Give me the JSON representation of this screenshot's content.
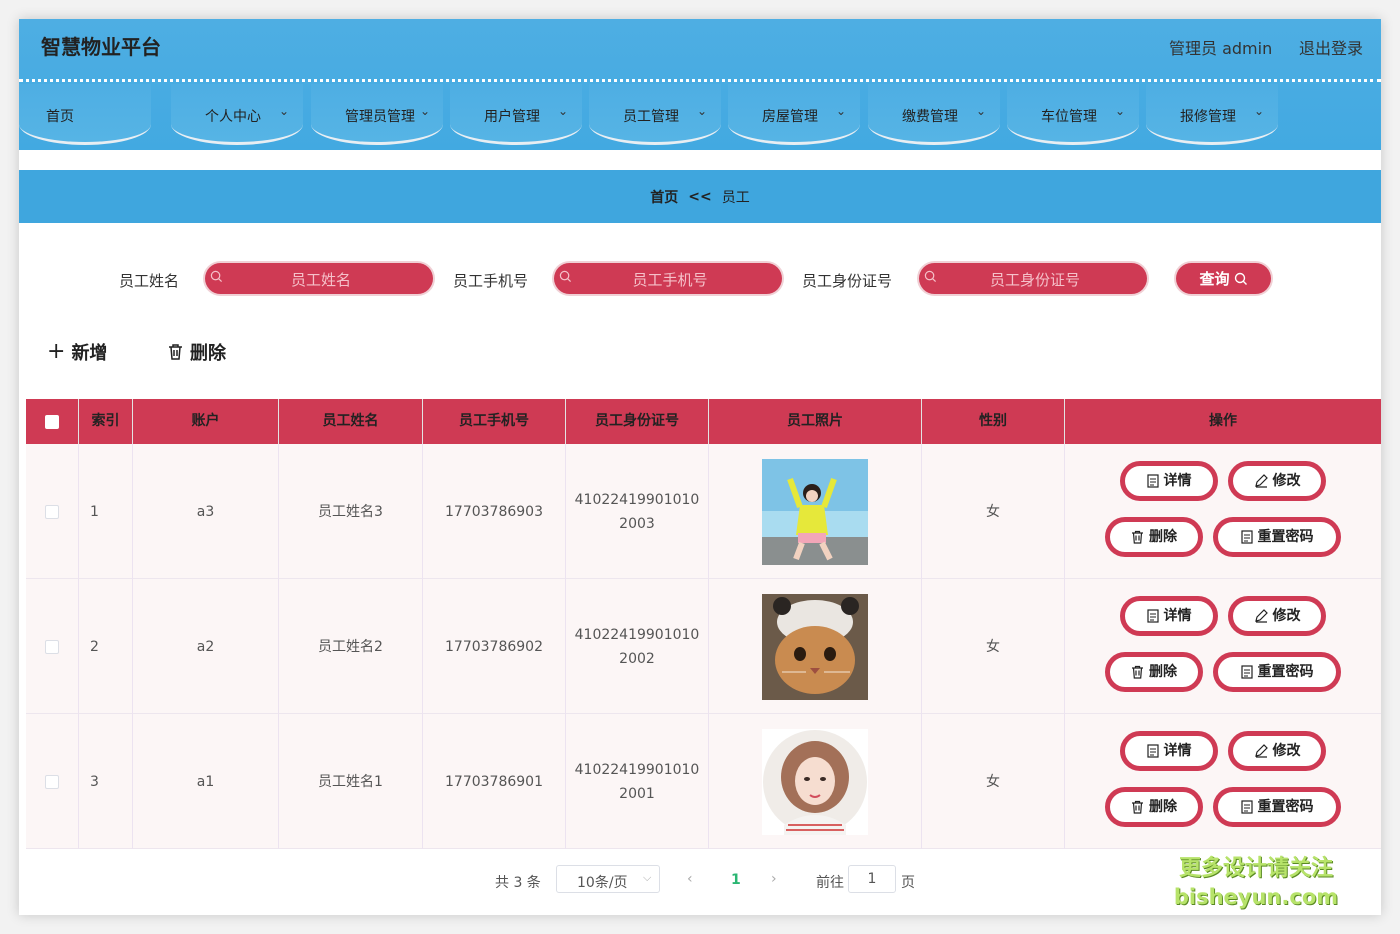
{
  "header": {
    "title": "智慧物业平台",
    "user_label": "管理员 admin",
    "logout_label": "退出登录"
  },
  "nav": {
    "items": [
      {
        "label": "首页",
        "has_dropdown": false
      },
      {
        "label": "个人中心",
        "has_dropdown": true
      },
      {
        "label": "管理员管理",
        "has_dropdown": true
      },
      {
        "label": "用户管理",
        "has_dropdown": true
      },
      {
        "label": "员工管理",
        "has_dropdown": true
      },
      {
        "label": "房屋管理",
        "has_dropdown": true
      },
      {
        "label": "缴费管理",
        "has_dropdown": true
      },
      {
        "label": "车位管理",
        "has_dropdown": true
      },
      {
        "label": "报修管理",
        "has_dropdown": true
      }
    ]
  },
  "breadcrumb": {
    "home": "首页",
    "separator": "<<",
    "current": "员工"
  },
  "search": {
    "name_label": "员工姓名",
    "name_placeholder": "员工姓名",
    "phone_label": "员工手机号",
    "phone_placeholder": "员工手机号",
    "id_label": "员工身份证号",
    "id_placeholder": "员工身份证号",
    "query_label": "查询"
  },
  "actions": {
    "add_label": "新增",
    "delete_label": "删除"
  },
  "table": {
    "headers": [
      "索引",
      "账户",
      "员工姓名",
      "员工手机号",
      "员工身份证号",
      "员工照片",
      "性别",
      "操作"
    ],
    "rows": [
      {
        "index": "1",
        "account": "a3",
        "name": "员工姓名3",
        "phone": "17703786903",
        "id_line1": "41022419901010",
        "id_line2": "2003",
        "photo": "girl-beach-photo",
        "gender": "女"
      },
      {
        "index": "2",
        "account": "a2",
        "name": "员工姓名2",
        "phone": "17703786902",
        "id_line1": "41022419901010",
        "id_line2": "2002",
        "photo": "cat-hat-photo",
        "gender": "女"
      },
      {
        "index": "3",
        "account": "a1",
        "name": "员工姓名1",
        "phone": "17703786901",
        "id_line1": "41022419901010",
        "id_line2": "2001",
        "photo": "girl-illustration-avatar",
        "gender": "女"
      }
    ],
    "op_labels": {
      "detail": "详情",
      "edit": "修改",
      "delete": "删除",
      "reset": "重置密码"
    }
  },
  "pager": {
    "total": "共 3 条",
    "page_size": "10条/页",
    "current_page": "1",
    "goto_label": "前往",
    "goto_value": "1",
    "page_unit": "页"
  },
  "watermark": {
    "line1": "更多设计请关注",
    "line2": "bisheyun.com"
  },
  "colors": {
    "header": "#42a9e1",
    "accent": "#cf3a54",
    "row_bg": "#fcf6f6",
    "page_active": "#2bb673"
  }
}
